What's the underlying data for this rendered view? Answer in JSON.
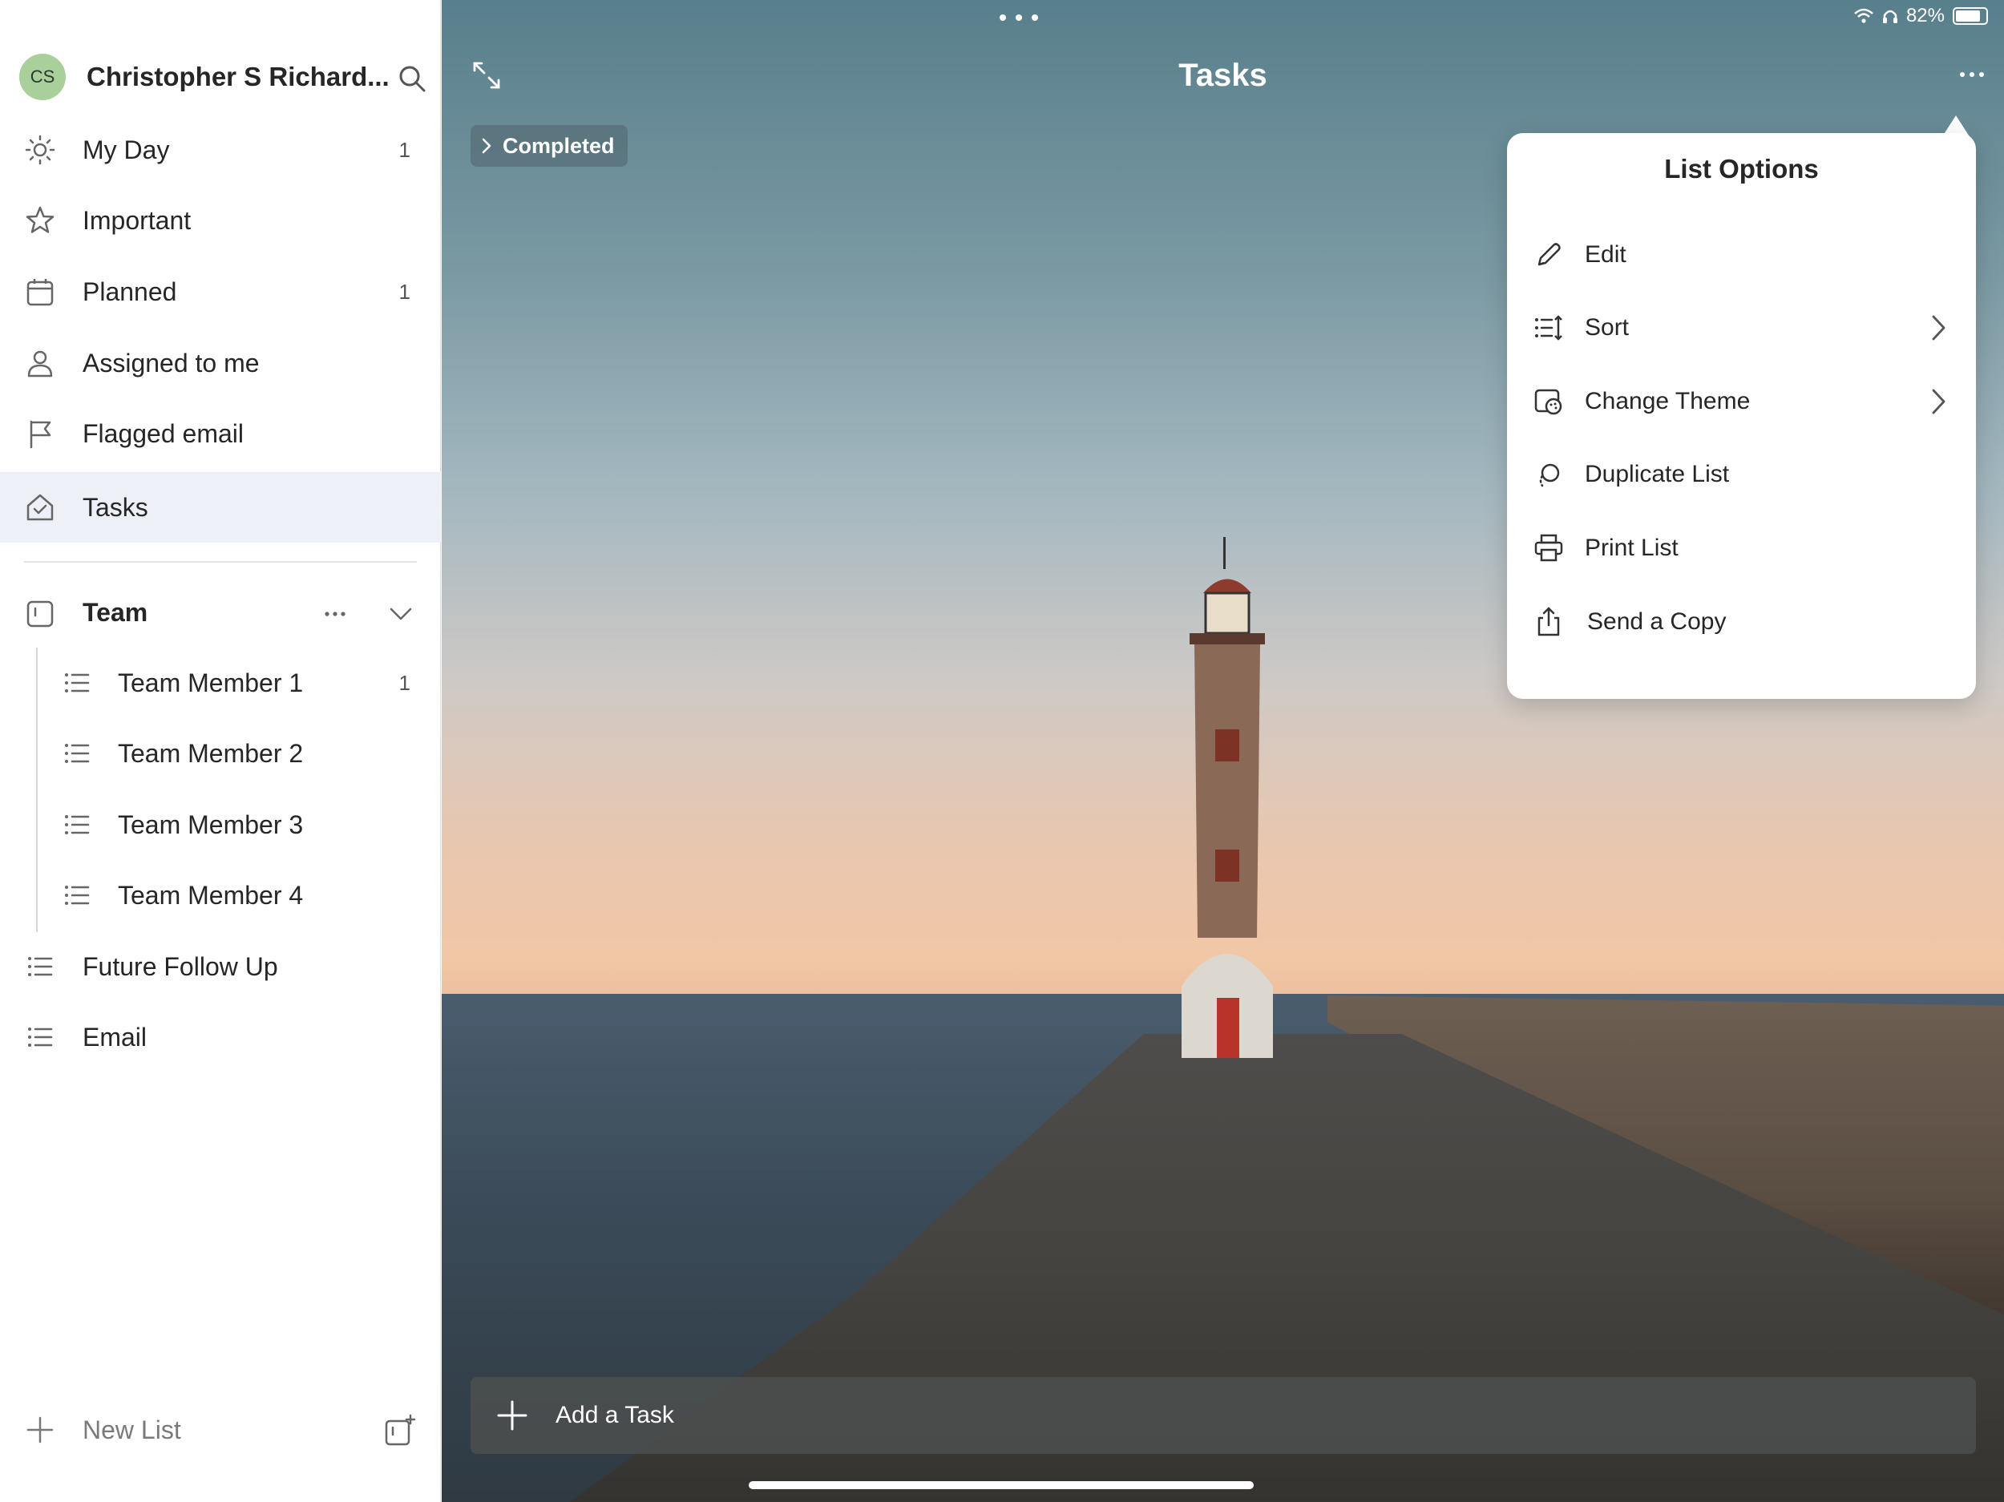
{
  "status_bar": {
    "battery": "82%",
    "battery_level": 0.82
  },
  "profile": {
    "initials": "CS",
    "name": "Christopher S Richard..."
  },
  "nav": [
    {
      "label": "My Day",
      "count": "1",
      "icon": "sun-icon"
    },
    {
      "label": "Important",
      "count": "",
      "icon": "star-icon"
    },
    {
      "label": "Planned",
      "count": "1",
      "icon": "calendar-icon"
    },
    {
      "label": "Assigned to me",
      "count": "",
      "icon": "person-icon"
    },
    {
      "label": "Flagged email",
      "count": "",
      "icon": "flag-icon"
    },
    {
      "label": "Tasks",
      "count": "",
      "icon": "home-icon"
    }
  ],
  "group": {
    "label": "Team",
    "items": [
      {
        "label": "Team Member 1",
        "count": "1"
      },
      {
        "label": "Team Member 2",
        "count": ""
      },
      {
        "label": "Team Member 3",
        "count": ""
      },
      {
        "label": "Team Member 4",
        "count": ""
      }
    ]
  },
  "lists": [
    {
      "label": "Future Follow Up"
    },
    {
      "label": "Email"
    }
  ],
  "new_list": {
    "label": "New List"
  },
  "main": {
    "title": "Tasks",
    "completed_label": "Completed",
    "add_task_label": "Add a Task"
  },
  "list_options": {
    "title": "List Options",
    "items": [
      {
        "label": "Edit",
        "icon": "pencil-icon",
        "has_submenu": false
      },
      {
        "label": "Sort",
        "icon": "sort-icon",
        "has_submenu": true
      },
      {
        "label": "Change Theme",
        "icon": "theme-icon",
        "has_submenu": true
      },
      {
        "label": "Duplicate List",
        "icon": "duplicate-icon",
        "has_submenu": false
      },
      {
        "label": "Print List",
        "icon": "print-icon",
        "has_submenu": false
      },
      {
        "label": "Send a Copy",
        "icon": "share-icon",
        "has_submenu": false
      }
    ]
  },
  "colors": {
    "accent_active_bg": "#eef0f8",
    "avatar_bg": "#a9cf9a"
  }
}
